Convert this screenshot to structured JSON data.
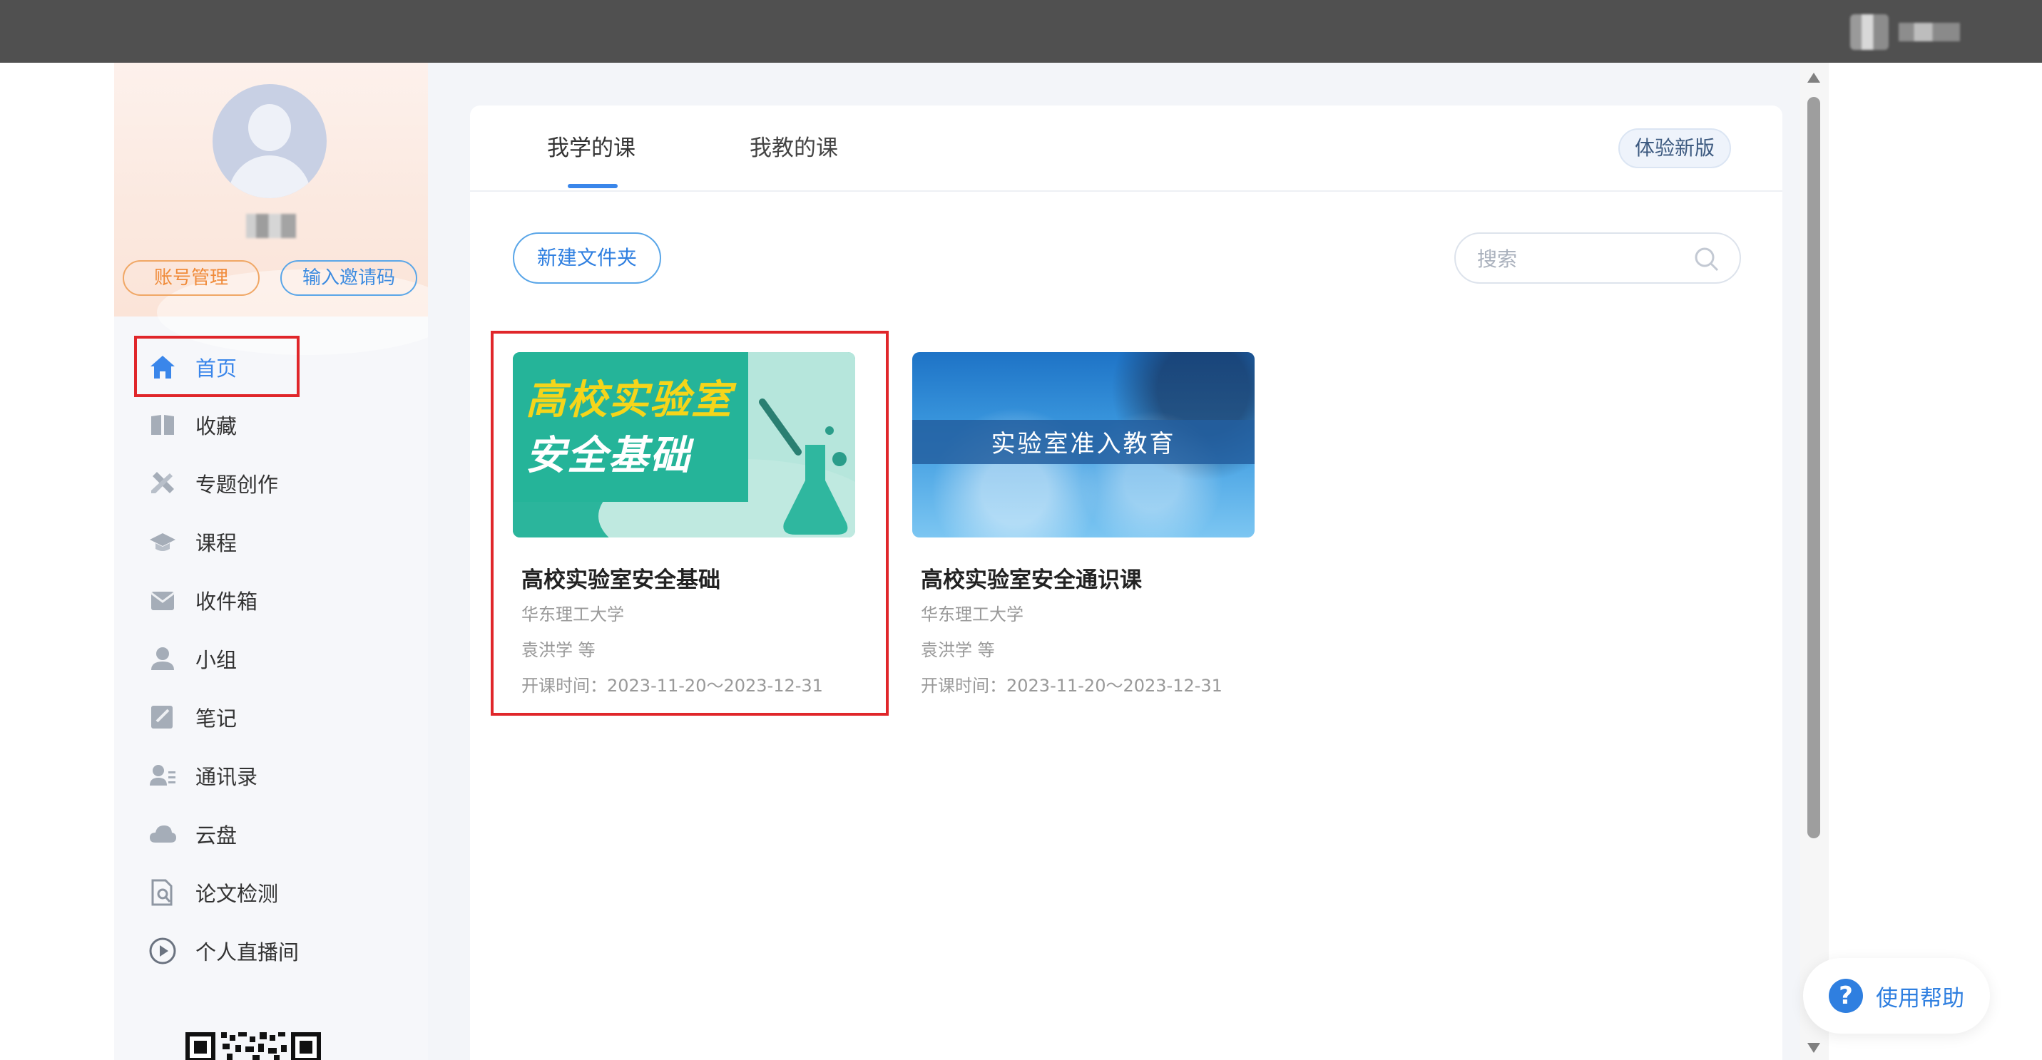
{
  "sidebar": {
    "account_btn": "账号管理",
    "invite_btn": "输入邀请码",
    "items": [
      {
        "label": "首页",
        "icon": "home-icon",
        "active": true
      },
      {
        "label": "收藏",
        "icon": "book-icon"
      },
      {
        "label": "专题创作",
        "icon": "tools-icon"
      },
      {
        "label": "课程",
        "icon": "graduation-cap-icon"
      },
      {
        "label": "收件箱",
        "icon": "inbox-icon"
      },
      {
        "label": "小组",
        "icon": "person-icon"
      },
      {
        "label": "笔记",
        "icon": "note-icon"
      },
      {
        "label": "通讯录",
        "icon": "contacts-icon"
      },
      {
        "label": "云盘",
        "icon": "cloud-icon"
      },
      {
        "label": "论文检测",
        "icon": "document-search-icon"
      },
      {
        "label": "个人直播间",
        "icon": "play-circle-icon"
      }
    ]
  },
  "main": {
    "tabs": [
      {
        "label": "我学的课",
        "active": true
      },
      {
        "label": "我教的课",
        "active": false
      }
    ],
    "new_version_btn": "体验新版",
    "new_folder_btn": "新建文件夹",
    "search_placeholder": "搜索",
    "courses": [
      {
        "thumb_text_1": "高校实验室",
        "thumb_text_2": "安全基础",
        "title": "高校实验室安全基础",
        "school": "华东理工大学",
        "teacher": "袁洪学 等",
        "period": "开课时间：2023-11-20～2023-12-31"
      },
      {
        "thumb_text_1": "实验室准入教育",
        "title": "高校实验室安全通识课",
        "school": "华东理工大学",
        "teacher": "袁洪学 等",
        "period": "开课时间：2023-11-20～2023-12-31"
      }
    ]
  },
  "help": {
    "label": "使用帮助"
  },
  "colors": {
    "accent": "#3a86ea",
    "highlight": "#e0262a",
    "orange": "#f08b3a"
  }
}
